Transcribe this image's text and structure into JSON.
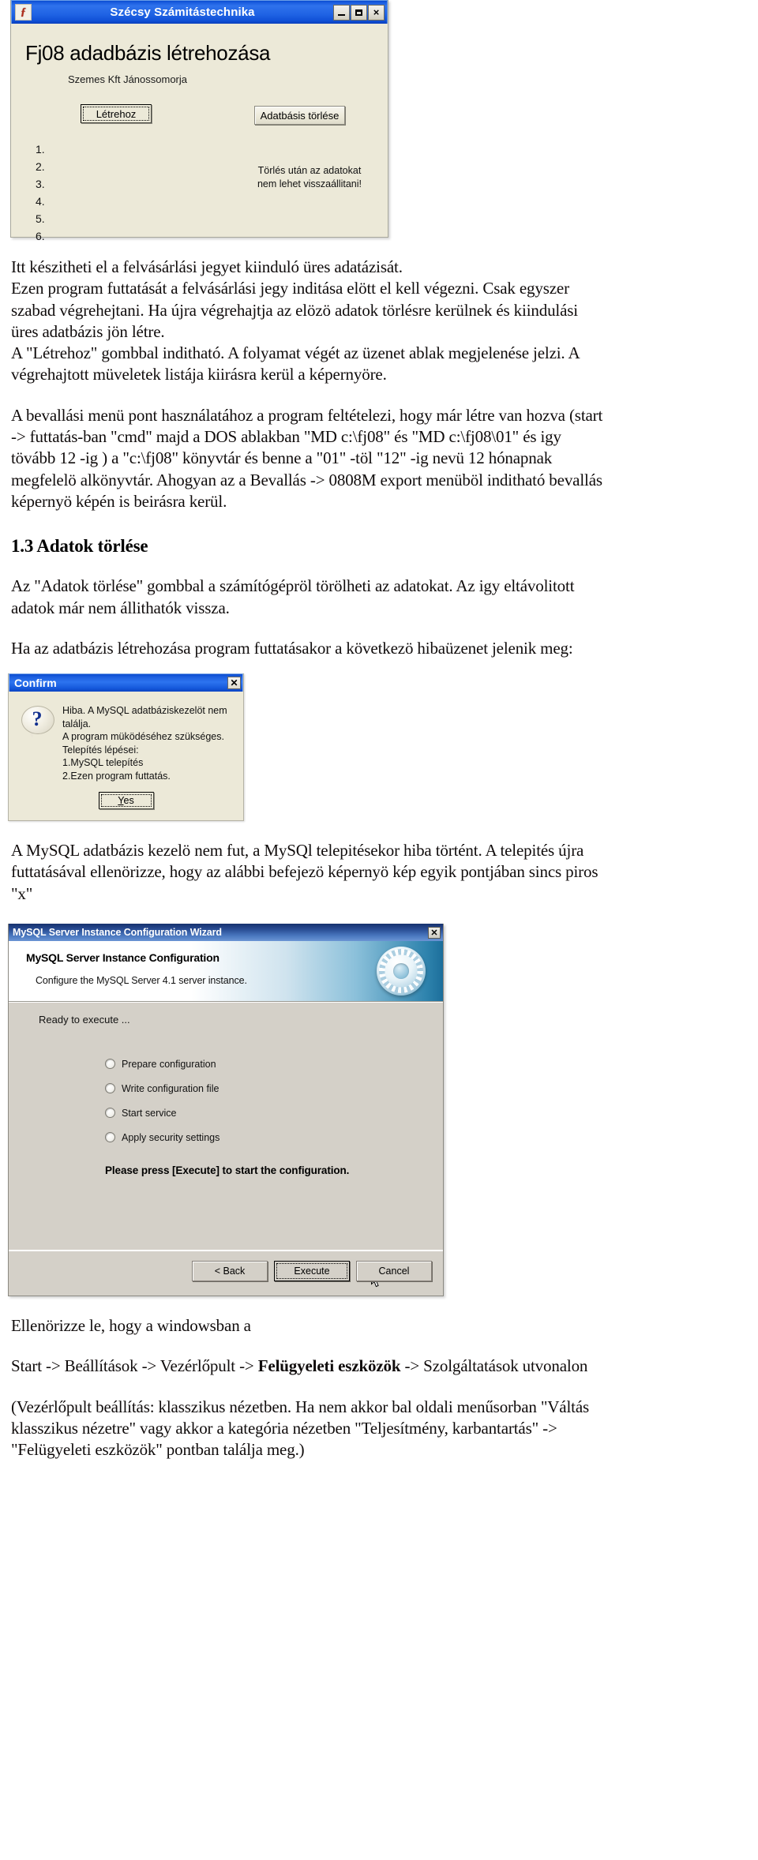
{
  "window_app": {
    "title": "Szécsy Számitástechnika",
    "icon": "app-logo-icon",
    "titlebar_buttons": {
      "minimize": "minimize-icon",
      "maximize": "maximize-icon",
      "close": "×"
    },
    "heading": "Fj08 adadbázis létrehozása",
    "subtitle": "Szemes Kft Jánossomorja",
    "create_button": "Létrehoz",
    "delete_button": "Adatbásis törlése",
    "list_items": [
      "1.",
      "2.",
      "3.",
      "4.",
      "5.",
      "6."
    ],
    "warning_line1": "Törlés után az adatokat",
    "warning_line2": "nem lehet visszaállitani!"
  },
  "body": {
    "para1_line1": "Itt készitheti el a felvásárlási jegyet kiinduló üres adatázisát.",
    "para1_line2": "Ezen program futtatását a felvásárlási jegy inditása elött el kell végezni. Csak egyszer",
    "para1_line3": "szabad végrehejtani. Ha újra végrehajtja az elözö adatok törlésre kerülnek és kiindulási",
    "para1_line4": "üres adatbázis jön létre.",
    "para1_line5": "A \"Létrehoz\" gombbal inditható. A folyamat végét az üzenet ablak megjelenése jelzi. A",
    "para1_line6": "végrehajtott müveletek listája kiirásra kerül a képernyöre.",
    "para2_line1": "A bevallási menü pont használatához a program feltételezi, hogy már létre van hozva (start",
    "para2_line2": "-> futtatás-ban \"cmd\" majd a DOS ablakban \"MD c:\\fj08\" és \"MD c:\\fj08\\01\" és igy",
    "para2_line3": "tövább 12 -ig ) a \"c:\\fj08\" könyvtár és benne a \"01\" -töl \"12\" -ig nevü 12 hónapnak",
    "para2_line4": "megfelelö alkönyvtár. Ahogyan az a Bevallás -> 0808M export menüböl inditható bevallás",
    "para2_line5": "képernyö képén is beirásra kerül.",
    "section_heading": "1.3 Adatok törlése",
    "para3_line1": "Az \"Adatok törlése\" gombbal a számítógépröl törölheti az adatokat. Az igy eltávolitott",
    "para3_line2": "adatok már nem állithatók vissza.",
    "para4_line1": "Ha az adatbázis létrehozása program futtatásakor a következö hibaüzenet jelenik meg:",
    "para5_line1": "A MySQL adatbázis kezelö nem fut, a MySQl telepitésekor hiba történt. A telepités újra",
    "para5_line2": "futtatásával ellenörizze, hogy az alábbi befejezö képernyö kép egyik pontjában sincs piros",
    "para5_line3": "\"x\"",
    "para6_line1": "Ellenörizze le, hogy a windowsban a",
    "para7_pre": "Start -> Beállítások -> Vezérlőpult -> ",
    "para7_bold": "Felügyeleti eszközök",
    "para7_post": " -> Szolgáltatások utvonalon",
    "para8_line1": "(Vezérlőpult beállítás: klasszikus nézetben. Ha nem akkor bal oldali menűsorban \"Váltás",
    "para8_line2": "klasszikus nézetre\" vagy akkor a kategória nézetben \"Teljesítmény, karbantartás\" ->",
    "para8_line3": "\"Felügyeleti eszközök\" pontban találja meg.)"
  },
  "confirm_dialog": {
    "title": "Confirm",
    "close_label": "✕",
    "icon": "question-bubble-icon",
    "icon_glyph": "?",
    "message_lines": [
      "Hiba. A MySQL adatbáziskezelöt nem találja.",
      "A program müködéséhez szükséges.",
      "Telepítés lépései:",
      "1.MySQL telepítés",
      "2.Ezen program futtatás."
    ],
    "yes_button": "Yes",
    "yes_accesskey": "Y"
  },
  "wizard": {
    "title": "MySQL Server Instance Configuration Wizard",
    "close_label": "✕",
    "banner_heading": "MySQL Server Instance Configuration",
    "banner_subtitle": "Configure the MySQL Server 4.1 server instance.",
    "gear_icon": "gear-icon",
    "status_text": "Ready to execute ...",
    "steps": [
      "Prepare configuration",
      "Write configuration file",
      "Start service",
      "Apply security settings"
    ],
    "prompt": "Please press [Execute] to start the configuration.",
    "back_button": "< Back",
    "execute_button": "Execute",
    "cancel_button": "Cancel",
    "cursor_icon": "mouse-pointer-icon"
  },
  "colors": {
    "window_face": "#ece9d8",
    "wizard_face": "#d4d0c8",
    "titlebar_blue": "#1f63e4",
    "wizard_titlebar": "#2b4f96",
    "banner_blue": "#2f84ae"
  }
}
